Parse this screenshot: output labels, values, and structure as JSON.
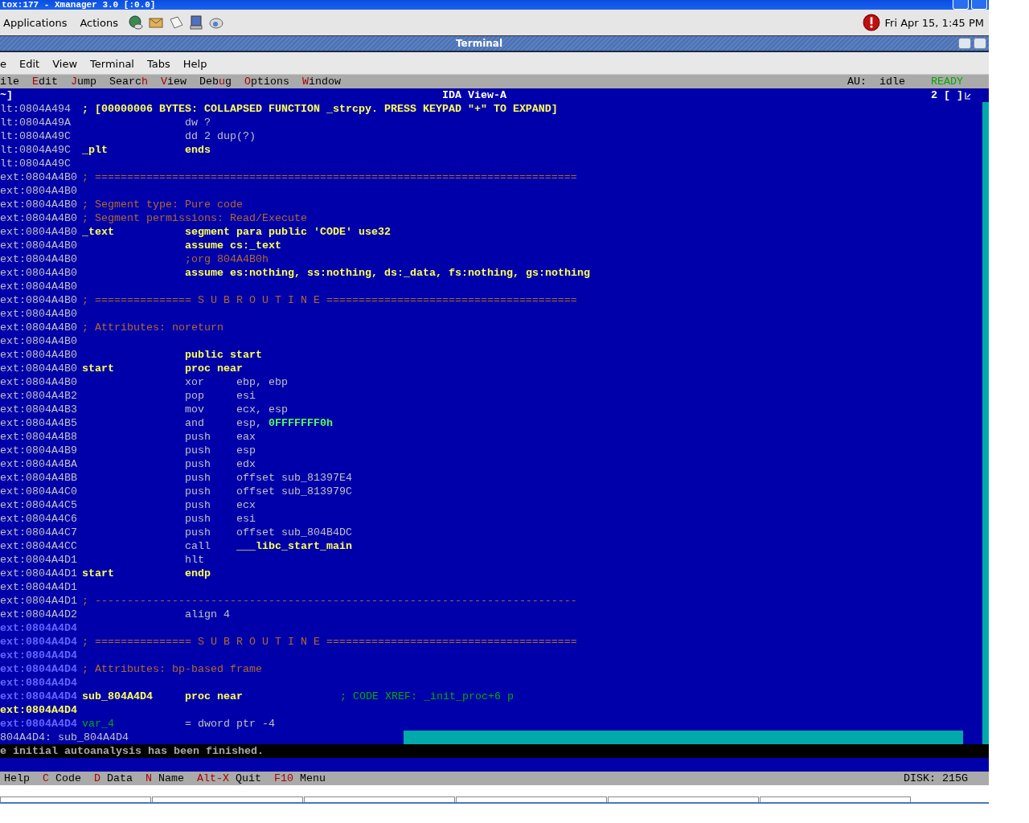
{
  "outer_window": {
    "title": "tox:177 - Xmanager 3.0 [:0.0]"
  },
  "panel": {
    "menus": [
      "Applications",
      "Actions"
    ],
    "clock": "Fri Apr 15,  1:45 PM"
  },
  "terminal": {
    "title": "Terminal",
    "menu": [
      "e",
      "Edit",
      "View",
      "Terminal",
      "Tabs",
      "Help"
    ]
  },
  "ida_menu": {
    "items": [
      {
        "pre": "ile"
      },
      {
        "key": "E",
        "post": "dit"
      },
      {
        "key": "J",
        "post": "ump"
      },
      {
        "pre": "Searc",
        "key": "h"
      },
      {
        "key": "V",
        "post": "iew"
      },
      {
        "pre": "Deb",
        "key": "u",
        "post": "g"
      },
      {
        "key": "O",
        "post": "ptions"
      },
      {
        "key": "W",
        "post": "indow"
      }
    ],
    "au_label": "AU:",
    "au_state": "idle",
    "ready": "READY"
  },
  "view": {
    "left": "~]",
    "title": "IDA View-A",
    "right": "2 [ ]",
    "lines": [
      {
        "addr": "lt:0804A494",
        "kind": "plain",
        "parts": [
          {
            "text": "; [00000006 BYTES: COLLAPSED FUNCTION _strcpy. PRESS KEYPAD \"+\" TO EXPAND]",
            "kind": "collapsed"
          }
        ]
      },
      {
        "addr": "lt:0804A49A",
        "kind": "plain",
        "parts": [
          {
            "text": "dw ?",
            "kind": "insn"
          }
        ]
      },
      {
        "addr": "lt:0804A49C",
        "kind": "plain",
        "parts": [
          {
            "text": "dd 2 dup(?)",
            "kind": "insn"
          }
        ]
      },
      {
        "addr": "lt:0804A49C",
        "kind": "plain",
        "parts": [
          {
            "text": "_plt",
            "kind": "name"
          },
          {
            "text": "ends",
            "kind": "directive"
          }
        ]
      },
      {
        "addr": "lt:0804A49C",
        "kind": "plain"
      },
      {
        "addr": "ext:0804A4B0",
        "kind": "plain",
        "parts": [
          {
            "text": "; ===========================================================================",
            "kind": "comment"
          }
        ]
      },
      {
        "addr": "ext:0804A4B0",
        "kind": "plain"
      },
      {
        "addr": "ext:0804A4B0",
        "kind": "plain",
        "parts": [
          {
            "text": "; Segment type: Pure code",
            "kind": "comment"
          }
        ]
      },
      {
        "addr": "ext:0804A4B0",
        "kind": "plain",
        "parts": [
          {
            "text": "; Segment permissions: Read/Execute",
            "kind": "comment"
          }
        ]
      },
      {
        "addr": "ext:0804A4B0",
        "kind": "plain",
        "parts": [
          {
            "text": "_text",
            "kind": "name"
          },
          {
            "text": "segment para public 'CODE' use32",
            "kind": "directive"
          }
        ]
      },
      {
        "addr": "ext:0804A4B0",
        "kind": "plain",
        "parts": [
          {
            "text": "assume cs:_text",
            "kind": "directive"
          }
        ]
      },
      {
        "addr": "ext:0804A4B0",
        "kind": "plain",
        "parts": [
          {
            "text": ";org 804A4B0h",
            "kind": "note"
          }
        ]
      },
      {
        "addr": "ext:0804A4B0",
        "kind": "plain",
        "parts": [
          {
            "text": "assume es:nothing, ss:nothing, ds:_data, fs:nothing, gs:nothing",
            "kind": "directive"
          }
        ]
      },
      {
        "addr": "ext:0804A4B0",
        "kind": "plain"
      },
      {
        "addr": "ext:0804A4B0",
        "kind": "plain",
        "parts": [
          {
            "text": "; =============== S U B R O U T I N E =======================================",
            "kind": "comment"
          }
        ]
      },
      {
        "addr": "ext:0804A4B0",
        "kind": "plain"
      },
      {
        "addr": "ext:0804A4B0",
        "kind": "plain",
        "parts": [
          {
            "text": "; Attributes: noreturn",
            "kind": "comment"
          }
        ]
      },
      {
        "addr": "ext:0804A4B0",
        "kind": "plain"
      },
      {
        "addr": "ext:0804A4B0",
        "kind": "plain",
        "parts": [
          {
            "text": "public start",
            "kind": "directive"
          }
        ]
      },
      {
        "addr": "ext:0804A4B0",
        "kind": "plain",
        "parts": [
          {
            "text": "start",
            "kind": "name"
          },
          {
            "text": "proc near",
            "kind": "directive"
          }
        ]
      },
      {
        "addr": "ext:0804A4B0",
        "kind": "plain",
        "parts": [
          {
            "text": "xor",
            "kind": "insn"
          },
          {
            "text": "ebp, ebp",
            "kind": "operand"
          }
        ]
      },
      {
        "addr": "ext:0804A4B2",
        "kind": "plain",
        "parts": [
          {
            "text": "pop",
            "kind": "insn"
          },
          {
            "text": "esi",
            "kind": "operand"
          }
        ]
      },
      {
        "addr": "ext:0804A4B3",
        "kind": "plain",
        "parts": [
          {
            "text": "mov",
            "kind": "insn"
          },
          {
            "text": "ecx, esp",
            "kind": "operand"
          }
        ]
      },
      {
        "addr": "ext:0804A4B5",
        "kind": "plain",
        "parts": [
          {
            "text": "and",
            "kind": "insn"
          },
          {
            "text": "esp,",
            "kind": "operand"
          },
          {
            "text": "0FFFFFFF0h",
            "kind": "number"
          }
        ]
      },
      {
        "addr": "ext:0804A4B8",
        "kind": "plain",
        "parts": [
          {
            "text": "push",
            "kind": "insn"
          },
          {
            "text": "eax",
            "kind": "operand"
          }
        ]
      },
      {
        "addr": "ext:0804A4B9",
        "kind": "plain",
        "parts": [
          {
            "text": "push",
            "kind": "insn"
          },
          {
            "text": "esp",
            "kind": "operand"
          }
        ]
      },
      {
        "addr": "ext:0804A4BA",
        "kind": "plain",
        "parts": [
          {
            "text": "push",
            "kind": "insn"
          },
          {
            "text": "edx",
            "kind": "operand"
          }
        ]
      },
      {
        "addr": "ext:0804A4BB",
        "kind": "plain",
        "parts": [
          {
            "text": "push",
            "kind": "insn"
          },
          {
            "text": "offset sub_81397E4",
            "kind": "operand"
          }
        ]
      },
      {
        "addr": "ext:0804A4C0",
        "kind": "plain",
        "parts": [
          {
            "text": "push",
            "kind": "insn"
          },
          {
            "text": "offset sub_813979C",
            "kind": "operand"
          }
        ]
      },
      {
        "addr": "ext:0804A4C5",
        "kind": "plain",
        "parts": [
          {
            "text": "push",
            "kind": "insn"
          },
          {
            "text": "ecx",
            "kind": "operand"
          }
        ]
      },
      {
        "addr": "ext:0804A4C6",
        "kind": "plain",
        "parts": [
          {
            "text": "push",
            "kind": "insn"
          },
          {
            "text": "esi",
            "kind": "operand"
          }
        ]
      },
      {
        "addr": "ext:0804A4C7",
        "kind": "plain",
        "parts": [
          {
            "text": "push",
            "kind": "insn"
          },
          {
            "text": "offset sub_804B4DC",
            "kind": "operand"
          }
        ]
      },
      {
        "addr": "ext:0804A4CC",
        "kind": "plain",
        "parts": [
          {
            "text": "call",
            "kind": "insn"
          },
          {
            "text": "___libc_start_main",
            "kind": "symbol"
          }
        ]
      },
      {
        "addr": "ext:0804A4D1",
        "kind": "plain",
        "parts": [
          {
            "text": "hlt",
            "kind": "insn"
          }
        ]
      },
      {
        "addr": "ext:0804A4D1",
        "kind": "plain",
        "parts": [
          {
            "text": "start",
            "kind": "name"
          },
          {
            "text": "endp",
            "kind": "directive"
          }
        ]
      },
      {
        "addr": "ext:0804A4D1",
        "kind": "plain"
      },
      {
        "addr": "ext:0804A4D1",
        "kind": "plain",
        "parts": [
          {
            "text": "; ---------------------------------------------------------------------------",
            "kind": "comment"
          }
        ]
      },
      {
        "addr": "ext:0804A4D2",
        "kind": "plain",
        "parts": [
          {
            "text": "align 4",
            "kind": "insn"
          }
        ]
      },
      {
        "addr": "ext:0804A4D4",
        "kind": "func"
      },
      {
        "addr": "ext:0804A4D4",
        "kind": "func",
        "parts": [
          {
            "text": "; =============== S U B R O U T I N E =======================================",
            "kind": "comment"
          }
        ]
      },
      {
        "addr": "ext:0804A4D4",
        "kind": "func"
      },
      {
        "addr": "ext:0804A4D4",
        "kind": "func",
        "parts": [
          {
            "text": "; Attributes: bp-based frame",
            "kind": "comment"
          }
        ]
      },
      {
        "addr": "ext:0804A4D4",
        "kind": "func"
      },
      {
        "addr": "ext:0804A4D4",
        "kind": "func",
        "parts": [
          {
            "text": "sub_804A4D4",
            "kind": "name"
          },
          {
            "text": "proc near",
            "kind": "directive"
          },
          {
            "text": "; CODE XREF: _init_proc+6 p",
            "kind": "xref"
          }
        ]
      },
      {
        "addr": "ext:0804A4D4",
        "kind": "cursor"
      },
      {
        "addr": "ext:0804A4D4",
        "kind": "func",
        "parts": [
          {
            "text": "var_4",
            "kind": "local"
          },
          {
            "text": "= dword ptr -4",
            "kind": "insn"
          }
        ]
      }
    ],
    "location": "804A4D4: sub_804A4D4"
  },
  "message": "e initial autoanalysis has been finished.",
  "keys": {
    "items": [
      {
        "label": "Help"
      },
      {
        "key": "C",
        "label": "Code"
      },
      {
        "key": "D",
        "label": "Data"
      },
      {
        "key": "N",
        "label": "Name"
      },
      {
        "key": "Alt-X",
        "label": "Quit"
      },
      {
        "key": "F10",
        "label": "Menu"
      }
    ],
    "disk": "DISK: 215G"
  }
}
